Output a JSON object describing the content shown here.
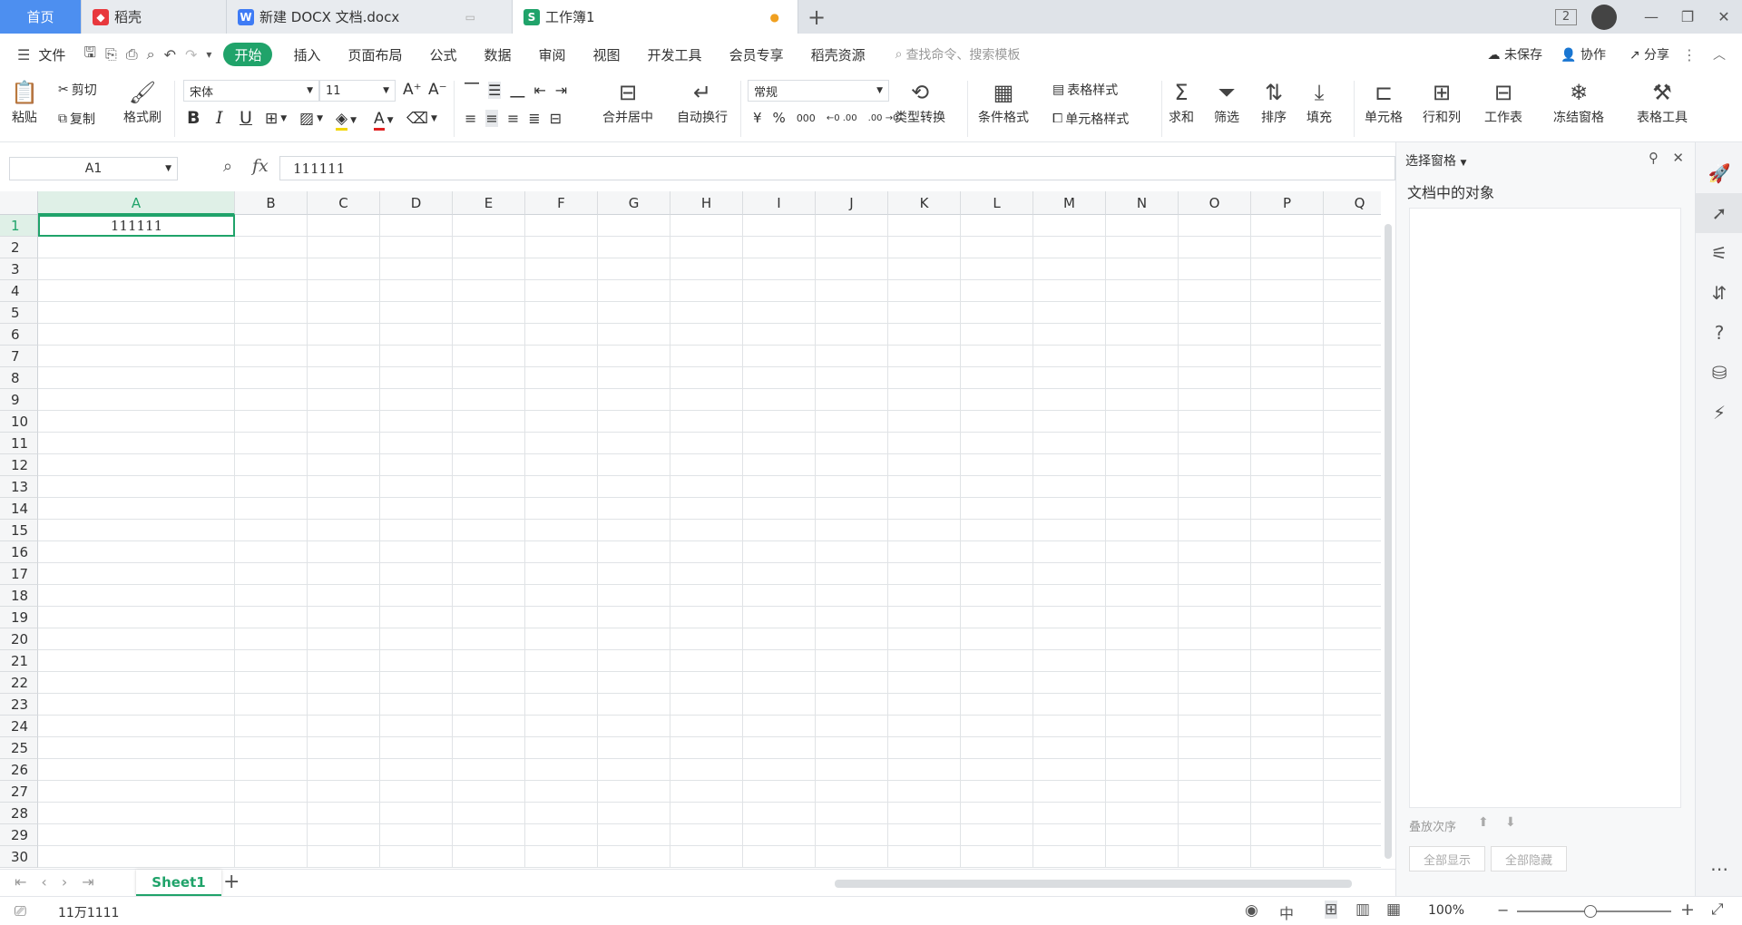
{
  "tabs": [
    {
      "label": "首页"
    },
    {
      "label": "稻壳"
    },
    {
      "label": "新建 DOCX 文档.docx"
    },
    {
      "label": "工作簿1"
    }
  ],
  "window": {
    "badge": "2"
  },
  "menu": {
    "file": "文件",
    "items": [
      "开始",
      "插入",
      "页面布局",
      "公式",
      "数据",
      "审阅",
      "视图",
      "开发工具",
      "会员专享",
      "稻壳资源"
    ],
    "search_placeholder": "查找命令、搜索模板",
    "unsaved": "未保存",
    "collab": "协作",
    "share": "分享"
  },
  "ribbon": {
    "paste": "粘贴",
    "cut": "剪切",
    "copy": "复制",
    "format_painter": "格式刷",
    "font_name": "宋体",
    "font_size": "11",
    "bold": "B",
    "italic": "I",
    "underline": "U",
    "merge_center": "合并居中",
    "auto_wrap": "自动换行",
    "number_format": "常规",
    "type_convert": "类型转换",
    "cond_format": "条件格式",
    "table_style": "表格样式",
    "cell_style": "单元格样式",
    "sum": "求和",
    "filter": "筛选",
    "sort": "排序",
    "fill": "填充",
    "cell": "单元格",
    "row_col": "行和列",
    "worksheet": "工作表",
    "freeze": "冻结窗格",
    "table_tools": "表格工具",
    "currency": "¥",
    "percent": "%",
    "thousand": "000",
    "inc_dec": "←0 .00",
    "dec_dec": ".00 →0"
  },
  "formula": {
    "namebox": "A1",
    "fx": "fx",
    "value": "111111"
  },
  "grid": {
    "columns": [
      "A",
      "B",
      "C",
      "D",
      "E",
      "F",
      "G",
      "H",
      "I",
      "J",
      "K",
      "L",
      "M",
      "N",
      "O",
      "P",
      "Q"
    ],
    "rows": [
      "1",
      "2",
      "3",
      "4",
      "5",
      "6",
      "7",
      "8",
      "9",
      "10",
      "11",
      "12",
      "13",
      "14",
      "15",
      "16",
      "17",
      "18",
      "19",
      "20",
      "21",
      "22",
      "23",
      "24",
      "25",
      "26",
      "27",
      "28",
      "29",
      "30"
    ],
    "cell_a1": "111111"
  },
  "sheet": {
    "name": "Sheet1"
  },
  "status": {
    "sum": "11万1111",
    "zoom": "100%"
  },
  "sidepanel": {
    "title": "选择窗格",
    "subtitle": "文档中的对象",
    "order_label": "叠放次序",
    "show_all": "全部显示",
    "hide_all": "全部隐藏"
  },
  "colors": {
    "accent": "#20a36a",
    "home_tab": "#4d8ff0"
  }
}
